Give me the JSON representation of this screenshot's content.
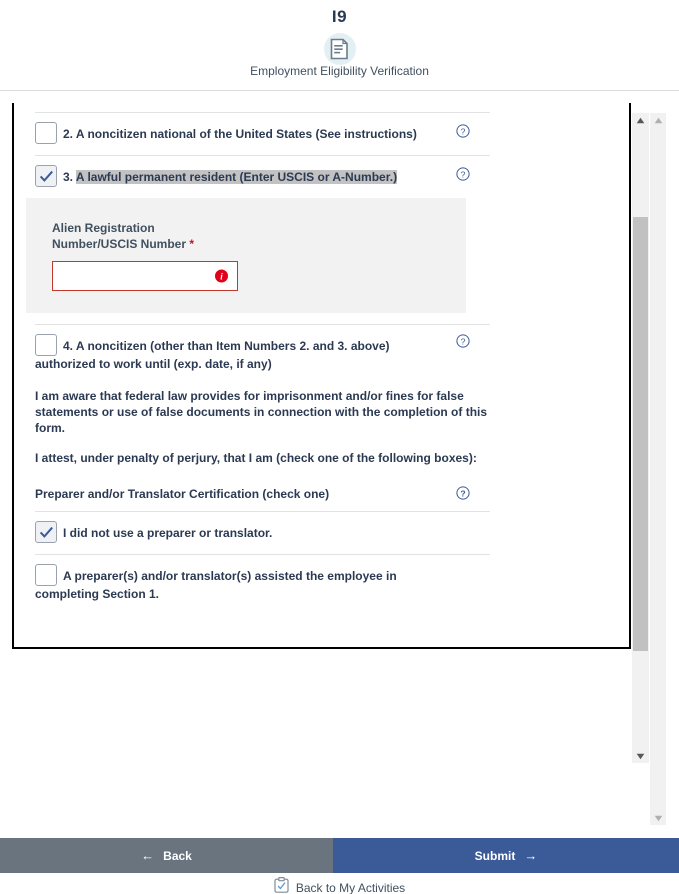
{
  "header": {
    "title": "I9",
    "icon": "document-icon",
    "subtitle": "Employment Eligibility Verification"
  },
  "form": {
    "options": [
      {
        "number": "2.",
        "label": "A noncitizen national of the United States (See instructions)",
        "checked": false,
        "highlighted": false,
        "help": "?"
      },
      {
        "number": "3.",
        "label": "A lawful permanent resident (Enter USCIS or A-Number.)",
        "checked": true,
        "highlighted": true,
        "help": "?"
      },
      {
        "number": "4.",
        "label": "A noncitizen (other than Item Numbers 2. and 3. above)",
        "label_line2": "authorized to work until (exp. date, if any)",
        "checked": false,
        "highlighted": false,
        "help": "?"
      }
    ],
    "alien_panel": {
      "label": "Alien Registration Number/USCIS Number",
      "required_marker": "*",
      "value": "",
      "placeholder": "",
      "error_icon": "error-info-icon"
    },
    "attestation_1": "I am aware that federal law provides for imprisonment and/or fines for false statements or use of false documents in connection with the completion of this form.",
    "attestation_2": "I attest, under penalty of perjury, that I am (check one of the following boxes):",
    "preparer_section": {
      "heading": "Preparer and/or Translator Certification (check one)",
      "help": "?",
      "options": [
        {
          "label": "I did not use a preparer or translator.",
          "checked": true
        },
        {
          "label": "A preparer(s) and/or translator(s) assisted the employee in",
          "label_line2": "completing Section 1.",
          "checked": false
        }
      ]
    }
  },
  "footer": {
    "back_label": "Back",
    "back_arrow": "←",
    "submit_label": "Submit",
    "submit_arrow": "→",
    "activities_label": "Back to My Activities",
    "activities_icon": "clipboard-check-icon"
  },
  "scrollbars": {
    "inner": {
      "up_arrow": "▲",
      "down_arrow": "▼"
    },
    "outer": {
      "up_arrow": "▲",
      "down_arrow": "▼"
    }
  },
  "colors": {
    "submit": "#3a5b98",
    "back": "#69747f",
    "error": "#c0392b",
    "text": "#2b3a52",
    "highlight": "#c2c2c2"
  }
}
